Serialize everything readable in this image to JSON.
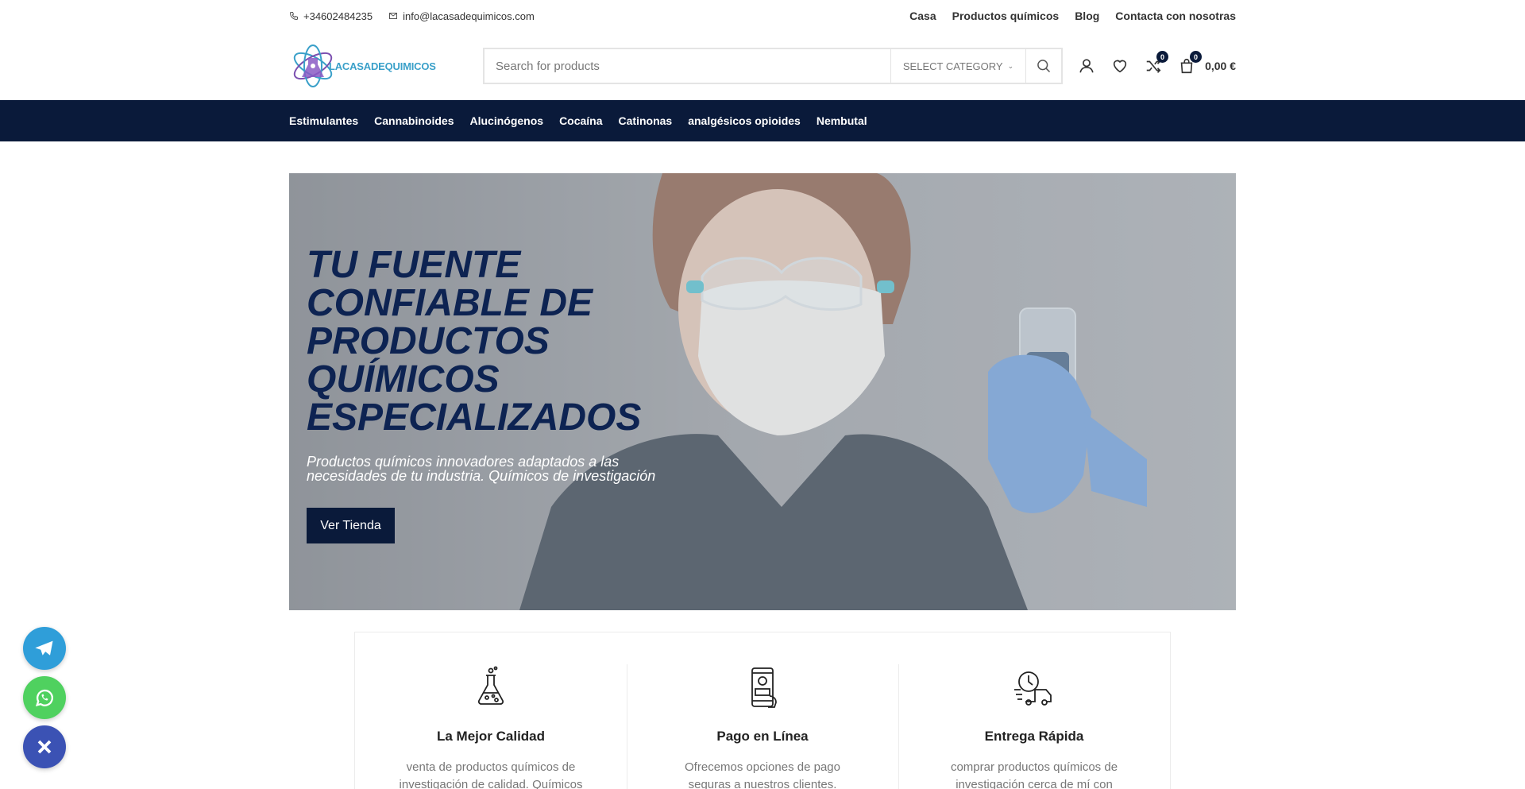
{
  "topbar": {
    "phone": "+34602484235",
    "email": "info@lacasadequimicos.com",
    "nav": [
      "Casa",
      "Productos químicos",
      "Blog",
      "Contacta con nosotras"
    ]
  },
  "header": {
    "logo_text": "LACASADEQUIMICOS",
    "search_placeholder": "Search for products",
    "category_label": "SELECT CATEGORY",
    "compare_count": "0",
    "cart_count": "0",
    "cart_total": "0,00 €"
  },
  "categories": [
    "Estimulantes",
    "Cannabinoides",
    "Alucinógenos",
    "Cocaína",
    "Catinonas",
    "analgésicos opioides",
    "Nembutal"
  ],
  "hero": {
    "title": "TU FUENTE CONFIABLE DE PRODUCTOS QUÍMICOS ESPECIALIZADOS",
    "subtitle": "Productos químicos innovadores adaptados a las necesidades de tu industria. Químicos de investigación",
    "cta": "Ver Tienda"
  },
  "features": [
    {
      "icon": "flask-icon",
      "title": "La Mejor Calidad",
      "text": "venta de productos químicos de investigación de calidad. Químicos de"
    },
    {
      "icon": "mobile-payment-icon",
      "title": "Pago en Línea",
      "text": "Ofrecemos opciones de pago seguras a nuestros clientes. productos químicos de"
    },
    {
      "icon": "delivery-truck-icon",
      "title": "Entrega Rápida",
      "text": "comprar productos químicos de investigación cerca de mí con entrega"
    }
  ],
  "colors": {
    "navy": "#0a1a3a",
    "hero_title": "#0d2352",
    "telegram": "#2f9ed9",
    "whatsapp": "#4fd15f",
    "close": "#3b52b4"
  }
}
